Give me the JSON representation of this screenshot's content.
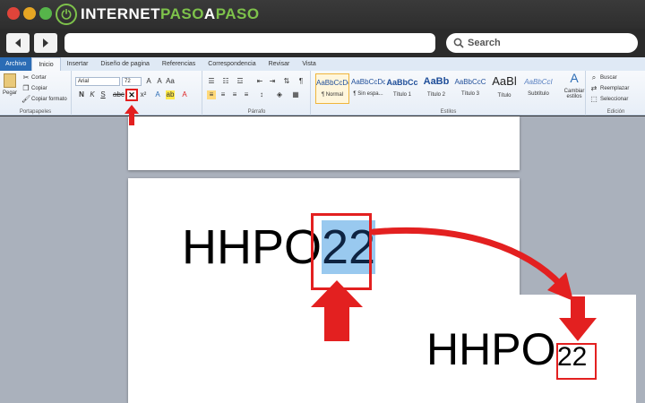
{
  "browser": {
    "logo_prefix": "INTERNET",
    "logo_accent": "PASO",
    "logo_mid": "A",
    "logo_suffix": "PASO",
    "search_label": "Search",
    "accent_color": "#7ec24b"
  },
  "ribbon": {
    "tabs": [
      "Archivo",
      "Inicio",
      "Insertar",
      "Diseño de pagina",
      "Referencias",
      "Correspondencia",
      "Revisar",
      "Vista"
    ],
    "active_tab": "Inicio",
    "clipboard": {
      "paste": "Pegar",
      "cut": "Cortar",
      "copy": "Copiar",
      "format_painter": "Copiar formato",
      "label": "Portapapeles"
    },
    "font": {
      "name": "Arial",
      "size": "72",
      "clear_format_glyph": "✕"
    },
    "paragraph_label": "Párrafo",
    "styles": {
      "items": [
        {
          "preview": "AaBbCcDc",
          "name": "¶ Normal"
        },
        {
          "preview": "AaBbCcDc",
          "name": "¶ Sin espa..."
        },
        {
          "preview": "AaBbCc",
          "name": "Título 1"
        },
        {
          "preview": "AaBb",
          "name": "Título 2"
        },
        {
          "preview": "AaBbCcC",
          "name": "Título 3"
        },
        {
          "preview": "AaBl",
          "name": "Título"
        },
        {
          "preview": "AaBbCcI",
          "name": "Subtítulo"
        }
      ],
      "change": "Cambiar estilos",
      "label": "Estilos"
    },
    "editing": {
      "find": "Buscar",
      "replace": "Reemplazar",
      "select": "Seleccionar",
      "label": "Edición"
    }
  },
  "document": {
    "text_base": "HHPO",
    "text_selected": "22"
  },
  "result": {
    "text_base": "HHPO",
    "text_sub": "22"
  },
  "colors": {
    "highlight": "#99c9ef",
    "annotation": "#e32020"
  }
}
